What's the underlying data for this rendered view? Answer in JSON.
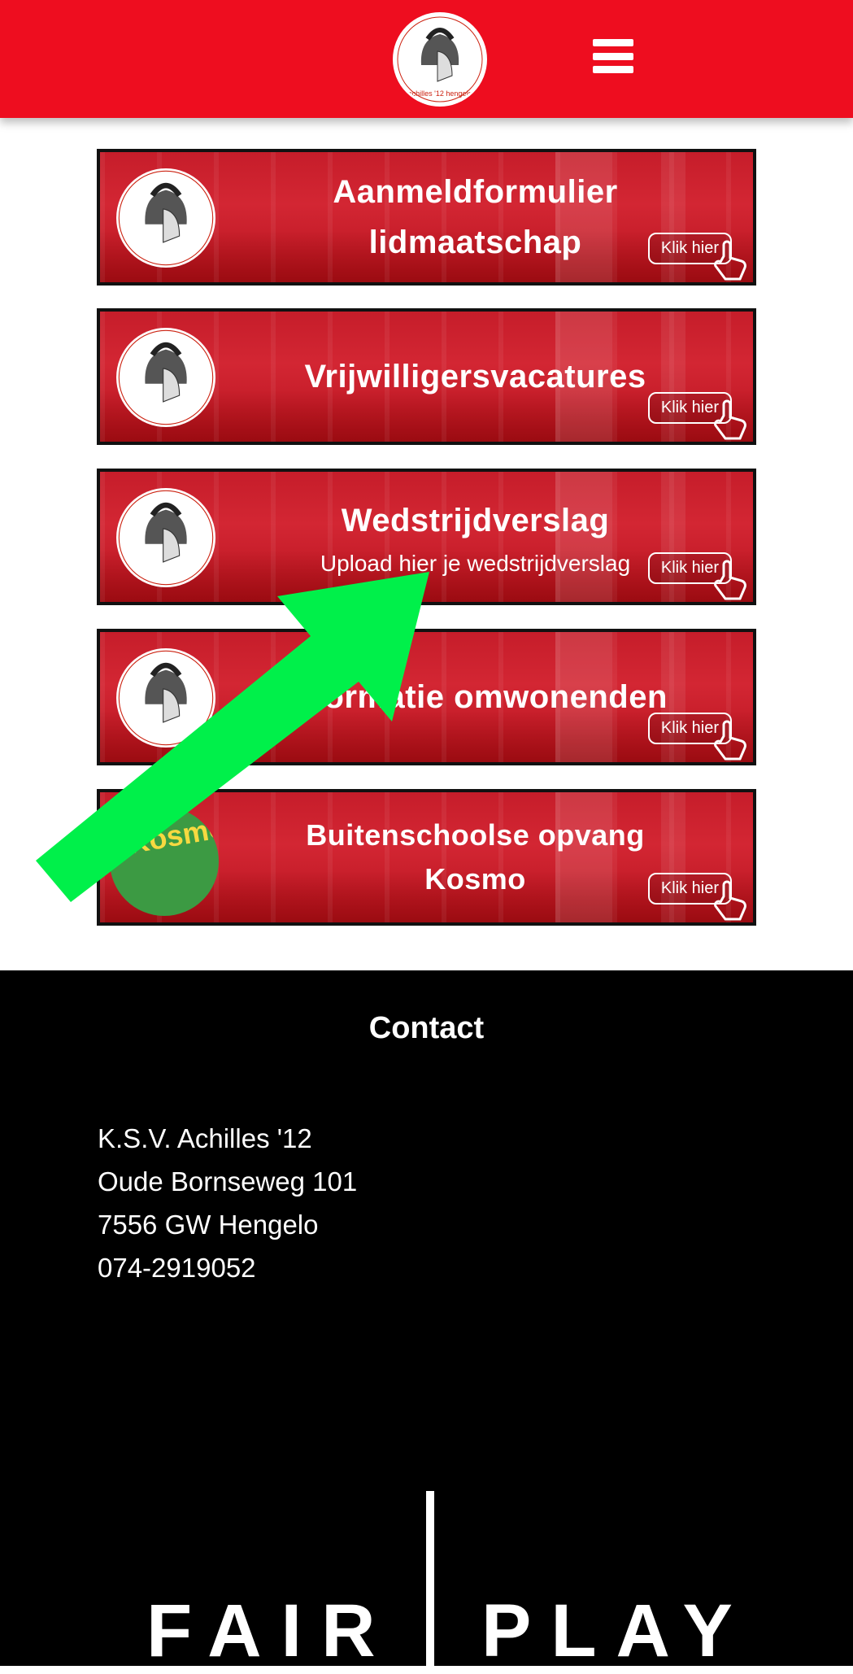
{
  "header": {
    "logo_icon": "achilles-helmet-logo-icon",
    "menu_icon": "hamburger-menu-icon",
    "brand_color": "#ee0d1f"
  },
  "banners": [
    {
      "title_line1": "Aanmeldformulier",
      "title_line2": "lidmaatschap",
      "subtitle": "",
      "cta": "Klik hier",
      "logo": "achilles"
    },
    {
      "title_line1": "Vrijwilligersvacatures",
      "title_line2": "",
      "subtitle": "",
      "cta": "Klik hier",
      "logo": "achilles"
    },
    {
      "title_line1": "Wedstrijdverslag",
      "title_line2": "",
      "subtitle": "Upload hier je wedstrijdverslag",
      "cta": "Klik hier",
      "logo": "achilles"
    },
    {
      "title_line1": "Informatie omwonenden",
      "title_line2": "",
      "subtitle": "",
      "cta": "Klik hier",
      "logo": "achilles"
    },
    {
      "title_line1": "Buitenschoolse opvang",
      "title_line2": "Kosmo",
      "subtitle": "",
      "cta": "Klik hier",
      "logo": "kosmo"
    }
  ],
  "kosmo_logo_text": "Kosmo",
  "annotation": {
    "arrow_color": "#00f04a",
    "arrow_icon": "green-arrow-icon"
  },
  "footer": {
    "contact_title": "Contact",
    "address": [
      "K.S.V. Achilles '12",
      "Oude Bornseweg 101",
      "7556 GW Hengelo",
      "074-2919052"
    ],
    "fair": "FAIR",
    "play": "PLAY"
  }
}
